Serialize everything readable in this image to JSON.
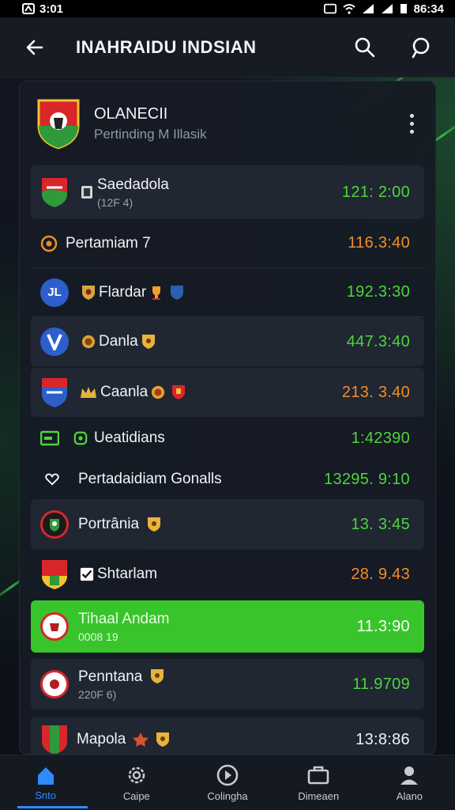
{
  "status_bar": {
    "time_left": "3:01",
    "time_right": "86:34"
  },
  "app_bar": {
    "title": "INAHRAIDU INDSIAN",
    "back_icon": "arrow-left-icon",
    "search_icon": "search-icon",
    "chat_icon": "chat-bubble-icon"
  },
  "header": {
    "title": "OLANECII",
    "subtitle": "Pertinding M Illasik"
  },
  "rows": [
    {
      "name": "Saedadola",
      "sub": "(12F 4)",
      "time": "121: 2:00",
      "time_color": "#4ed43c"
    },
    {
      "name": "Pertamiam 7",
      "time": "116.3:40",
      "time_color": "#f08f26"
    },
    {
      "name": "Flardar",
      "time": "192.3:30",
      "time_color": "#4ed43c"
    },
    {
      "name": "Danla",
      "time": "447.3:40",
      "time_color": "#4ed43c"
    },
    {
      "name": "Caanla",
      "time": "213. 3.40",
      "time_color": "#f08f26"
    },
    {
      "name": "Ueatidians",
      "time": "1:42390",
      "time_color": "#4ed43c"
    },
    {
      "name": "Pertadaidiam Gonalls",
      "time": "13295. 9:10",
      "time_color": "#4ed43c"
    },
    {
      "name": "Portrânia",
      "time": "13. 3:45",
      "time_color": "#4ed43c"
    },
    {
      "name": "Shtarlam",
      "time": "28. 9.43",
      "time_color": "#f08f26"
    },
    {
      "name": "Tihaal Andam",
      "sub": "0008 19",
      "time": "11.3:90",
      "time_color": "#ffffff"
    },
    {
      "name": "Penntana",
      "sub": "220F 6)",
      "time": "11.9709",
      "time_color": "#4ed43c"
    },
    {
      "name": "Mapola",
      "time": "13:8:86",
      "time_color": "#f1f3f5"
    }
  ],
  "nav": [
    {
      "label": "Snto",
      "icon": "home-icon"
    },
    {
      "label": "Caipe",
      "icon": "settings-gear-icon"
    },
    {
      "label": "Colingha",
      "icon": "play-circle-icon"
    },
    {
      "label": "Dimeaen",
      "icon": "briefcase-icon"
    },
    {
      "label": "Alano",
      "icon": "profile-icon"
    }
  ],
  "colors": {
    "accent_green": "#38c52c",
    "accent_blue": "#2f8bff",
    "orange": "#f08f26"
  }
}
